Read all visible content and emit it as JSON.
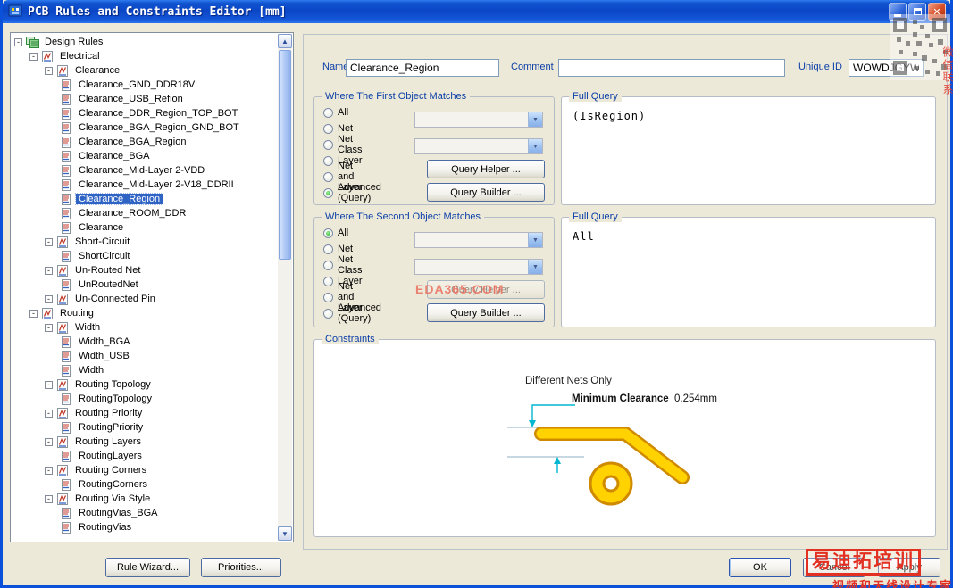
{
  "window": {
    "title": "PCB Rules and Constraints Editor [mm]"
  },
  "tree": {
    "items": [
      {
        "label": "Design Rules",
        "level": 0,
        "icon": "design-rules",
        "box": "minus"
      },
      {
        "label": "Electrical",
        "level": 1,
        "icon": "category",
        "box": "minus"
      },
      {
        "label": "Clearance",
        "level": 2,
        "icon": "rule-type",
        "box": "minus"
      },
      {
        "label": "Clearance_GND_DDR18V",
        "level": 3,
        "icon": "rule"
      },
      {
        "label": "Clearance_USB_Refion",
        "level": 3,
        "icon": "rule"
      },
      {
        "label": "Clearance_DDR_Region_TOP_BOT",
        "level": 3,
        "icon": "rule"
      },
      {
        "label": "Clearance_BGA_Region_GND_BOT",
        "level": 3,
        "icon": "rule"
      },
      {
        "label": "Clearance_BGA_Region",
        "level": 3,
        "icon": "rule"
      },
      {
        "label": "Clearance_BGA",
        "level": 3,
        "icon": "rule"
      },
      {
        "label": "Clearance_Mid-Layer 2-VDD",
        "level": 3,
        "icon": "rule"
      },
      {
        "label": "Clearance_Mid-Layer 2-V18_DDRII",
        "level": 3,
        "icon": "rule"
      },
      {
        "label": "Clearance_Region",
        "level": 3,
        "icon": "rule",
        "selected": true
      },
      {
        "label": "Clearance_ROOM_DDR",
        "level": 3,
        "icon": "rule"
      },
      {
        "label": "Clearance",
        "level": 3,
        "icon": "rule"
      },
      {
        "label": "Short-Circuit",
        "level": 2,
        "icon": "rule-type",
        "box": "minus"
      },
      {
        "label": "ShortCircuit",
        "level": 3,
        "icon": "rule"
      },
      {
        "label": "Un-Routed Net",
        "level": 2,
        "icon": "rule-type",
        "box": "minus"
      },
      {
        "label": "UnRoutedNet",
        "level": 3,
        "icon": "rule"
      },
      {
        "label": "Un-Connected Pin",
        "level": 2,
        "icon": "rule-type",
        "box": "minus"
      },
      {
        "label": "Routing",
        "level": 1,
        "icon": "category",
        "box": "minus"
      },
      {
        "label": "Width",
        "level": 2,
        "icon": "rule-type",
        "box": "minus"
      },
      {
        "label": "Width_BGA",
        "level": 3,
        "icon": "rule"
      },
      {
        "label": "Width_USB",
        "level": 3,
        "icon": "rule"
      },
      {
        "label": "Width",
        "level": 3,
        "icon": "rule"
      },
      {
        "label": "Routing Topology",
        "level": 2,
        "icon": "rule-type",
        "box": "minus"
      },
      {
        "label": "RoutingTopology",
        "level": 3,
        "icon": "rule"
      },
      {
        "label": "Routing Priority",
        "level": 2,
        "icon": "rule-type",
        "box": "minus"
      },
      {
        "label": "RoutingPriority",
        "level": 3,
        "icon": "rule"
      },
      {
        "label": "Routing Layers",
        "level": 2,
        "icon": "rule-type",
        "box": "minus"
      },
      {
        "label": "RoutingLayers",
        "level": 3,
        "icon": "rule"
      },
      {
        "label": "Routing Corners",
        "level": 2,
        "icon": "rule-type",
        "box": "minus"
      },
      {
        "label": "RoutingCorners",
        "level": 3,
        "icon": "rule"
      },
      {
        "label": "Routing Via Style",
        "level": 2,
        "icon": "rule-type",
        "box": "minus"
      },
      {
        "label": "RoutingVias_BGA",
        "level": 3,
        "icon": "rule"
      },
      {
        "label": "RoutingVias",
        "level": 3,
        "icon": "rule"
      }
    ]
  },
  "header": {
    "name_label": "Name",
    "name_value": "Clearance_Region",
    "comment_label": "Comment",
    "comment_value": "",
    "unique_id_label": "Unique ID",
    "unique_id_value": "WOWDJGYW"
  },
  "first_match": {
    "title": "Where The First Object Matches",
    "options": [
      {
        "label": "All",
        "selected": false
      },
      {
        "label": "Net",
        "selected": false
      },
      {
        "label": "Net Class",
        "selected": false
      },
      {
        "label": "Layer",
        "selected": false
      },
      {
        "label": "Net and Layer",
        "selected": false
      },
      {
        "label": "Advanced (Query)",
        "selected": true
      }
    ],
    "query_helper_button": "Query Helper ...",
    "query_builder_button": "Query Builder ..."
  },
  "first_query": {
    "title": "Full Query",
    "text": "(IsRegion)"
  },
  "second_match": {
    "title": "Where The Second Object Matches",
    "options": [
      {
        "label": "All",
        "selected": true
      },
      {
        "label": "Net",
        "selected": false
      },
      {
        "label": "Net Class",
        "selected": false
      },
      {
        "label": "Layer",
        "selected": false
      },
      {
        "label": "Net and Layer",
        "selected": false
      },
      {
        "label": "Advanced (Query)",
        "selected": false
      }
    ],
    "query_helper_button": "Query Helper ...",
    "query_builder_button": "Query Builder ..."
  },
  "second_query": {
    "title": "Full Query",
    "text": "All"
  },
  "constraints": {
    "title": "Constraints",
    "different_nets_label": "Different Nets Only",
    "min_clearance_label": "Minimum Clearance",
    "min_clearance_value": "0.254mm"
  },
  "footer": {
    "rule_wizard_button": "Rule Wizard...",
    "priorities_button": "Priorities...",
    "ok_button": "OK",
    "cancel_button": "Cancel",
    "apply_button": "Apply"
  },
  "watermarks": {
    "eda_text": "EDA365.COM",
    "brand_box": "易迪拓培训",
    "brand_sub": "视频和天线设计专家",
    "wechat_text": "微信联系"
  },
  "colors": {
    "selection": "#2f63c4",
    "accent-blue": "#0b3ea8",
    "trace-yellow": "#ffd200",
    "trace-outline": "#cf8a00",
    "arrow-cyan": "#00b6d0",
    "watermark-red": "#e23022"
  }
}
